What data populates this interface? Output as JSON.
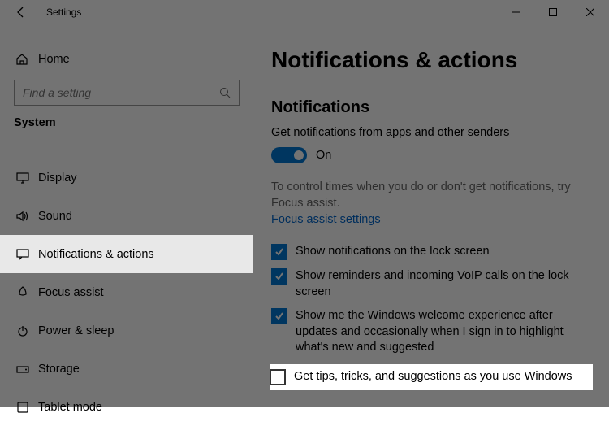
{
  "titlebar": {
    "title": "Settings"
  },
  "sidebar": {
    "home": "Home",
    "search_placeholder": "Find a setting",
    "group": "System",
    "items": [
      {
        "label": "Display"
      },
      {
        "label": "Sound"
      },
      {
        "label": "Notifications & actions"
      },
      {
        "label": "Focus assist"
      },
      {
        "label": "Power & sleep"
      },
      {
        "label": "Storage"
      },
      {
        "label": "Tablet mode"
      }
    ]
  },
  "content": {
    "page_title": "Notifications & actions",
    "section_title": "Notifications",
    "master_label": "Get notifications from apps and other senders",
    "master_state": "On",
    "desc": "To control times when you do or don't get notifications, try Focus assist.",
    "link": "Focus assist settings",
    "checks": [
      {
        "label": "Show notifications on the lock screen",
        "checked": true
      },
      {
        "label": "Show reminders and incoming VoIP calls on the lock screen",
        "checked": true
      },
      {
        "label": "Show me the Windows welcome experience after updates and occasionally when I sign in to highlight what's new and suggested",
        "checked": true
      },
      {
        "label": "Get tips, tricks, and suggestions as you use Windows",
        "checked": false
      }
    ]
  }
}
